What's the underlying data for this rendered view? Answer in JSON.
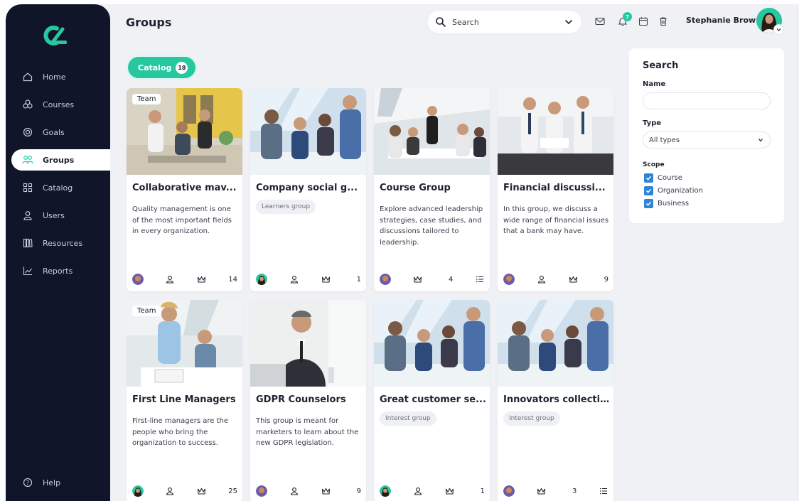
{
  "colors": {
    "accent": "#27c8a0",
    "sidebar_bg": "#10152a",
    "checkbox": "#2d84d8"
  },
  "sidebar": {
    "items": [
      {
        "label": "Home",
        "icon": "home-icon"
      },
      {
        "label": "Courses",
        "icon": "courses-icon"
      },
      {
        "label": "Goals",
        "icon": "target-icon"
      },
      {
        "label": "Groups",
        "icon": "groups-icon",
        "active": true
      },
      {
        "label": "Catalog",
        "icon": "grid-icon"
      },
      {
        "label": "Users",
        "icon": "user-icon"
      },
      {
        "label": "Resources",
        "icon": "books-icon"
      },
      {
        "label": "Reports",
        "icon": "chart-icon"
      }
    ],
    "help_label": "Help"
  },
  "header": {
    "title": "Groups",
    "search_label": "Search",
    "notification_count": "7",
    "user_name": "Stephanie Brown"
  },
  "catalog": {
    "label": "Catalog",
    "count": "18"
  },
  "cards": [
    {
      "title": "Collaborative mav...",
      "badge": "Team",
      "desc": "Quality management is one of the most important fields in every organization.",
      "tag": "",
      "count": "14",
      "list_icon": false
    },
    {
      "title": "Company social g...",
      "badge": "",
      "desc": "",
      "tag": "Learners group",
      "count": "1",
      "list_icon": false
    },
    {
      "title": "Course Group",
      "badge": "",
      "desc": "Explore advanced leadership strategies, case studies, and discussions tailored to leadership.",
      "tag": "",
      "count": "4",
      "list_icon": true
    },
    {
      "title": "Financial discussi...",
      "badge": "",
      "desc": "In this group, we discuss a wide range of financial issues that a bank may have.",
      "tag": "",
      "count": "9",
      "list_icon": false
    },
    {
      "title": "First Line Managers",
      "badge": "Team",
      "desc": "First-line managers are the people who bring the organization to success.",
      "tag": "",
      "count": "25",
      "list_icon": false
    },
    {
      "title": "GDPR Counselors",
      "badge": "",
      "desc": "This group is meant for marketers to learn about the new GDPR legislation.",
      "tag": "",
      "count": "9",
      "list_icon": false
    },
    {
      "title": "Great customer se...",
      "badge": "",
      "desc": "",
      "tag": "Interest group",
      "count": "1",
      "list_icon": false
    },
    {
      "title": "Innovators collecti...",
      "badge": "",
      "desc": "",
      "tag": "Interest group",
      "count": "3",
      "list_icon": true
    }
  ],
  "filters": {
    "title": "Search",
    "name_label": "Name",
    "name_value": "",
    "type_label": "Type",
    "type_value": "All types",
    "scope_label": "Scope",
    "scope_options": [
      {
        "label": "Course",
        "checked": true
      },
      {
        "label": "Organization",
        "checked": true
      },
      {
        "label": "Business",
        "checked": true
      }
    ]
  }
}
